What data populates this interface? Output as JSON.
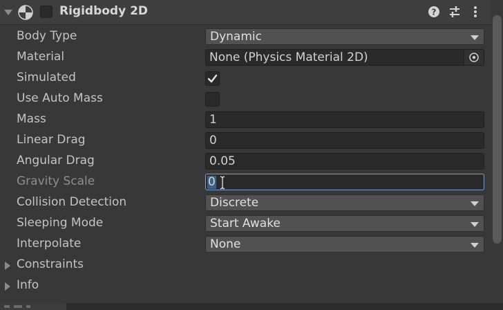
{
  "header": {
    "title": "Rigidbody 2D",
    "icons": [
      "rigidbody-2d-icon",
      "help-icon",
      "preset-icon",
      "more-options-icon"
    ]
  },
  "properties": {
    "body_type": {
      "label": "Body Type",
      "value": "Dynamic"
    },
    "material": {
      "label": "Material",
      "value": "None (Physics Material 2D)"
    },
    "simulated": {
      "label": "Simulated",
      "checked": true
    },
    "use_auto_mass": {
      "label": "Use Auto Mass",
      "checked": false
    },
    "mass": {
      "label": "Mass",
      "value": "1"
    },
    "linear_drag": {
      "label": "Linear Drag",
      "value": "0"
    },
    "angular_drag": {
      "label": "Angular Drag",
      "value": "0.05"
    },
    "gravity_scale": {
      "label": "Gravity Scale",
      "value": "0"
    },
    "collision_detection": {
      "label": "Collision Detection",
      "value": "Discrete"
    },
    "sleeping_mode": {
      "label": "Sleeping Mode",
      "value": "Start Awake"
    },
    "interpolate": {
      "label": "Interpolate",
      "value": "None"
    }
  },
  "foldouts": {
    "constraints": "Constraints",
    "info": "Info"
  },
  "colors": {
    "background": "#383838",
    "field": "#2a2a2a",
    "dropdown": "#515151",
    "focus": "#7aa2d6",
    "selection": "#3d6185"
  }
}
